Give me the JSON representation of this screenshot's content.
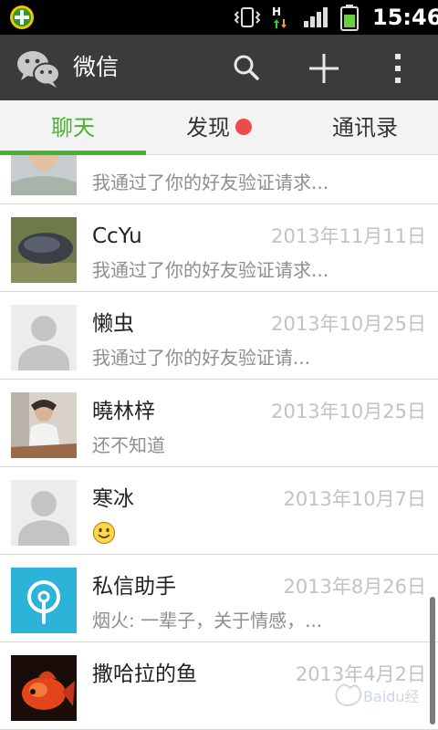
{
  "status_bar": {
    "time": "15:46",
    "network": "H"
  },
  "header": {
    "title": "微信"
  },
  "tabs": [
    {
      "label": "聊天",
      "active": true
    },
    {
      "label": "发现",
      "badge": "dot"
    },
    {
      "label": "通讯录"
    }
  ],
  "conversations": [
    {
      "name": "",
      "date": "",
      "message": "我通过了你的好友验证请求..."
    },
    {
      "name": "CcYu",
      "date": "2013年11月11日",
      "message": "我通过了你的好友验证请求..."
    },
    {
      "name": "懒虫",
      "date": "2013年10月25日",
      "message": "我通过了你的好友验证请..."
    },
    {
      "name": "曉林梓",
      "date": "2013年10月25日",
      "message": "还不知道"
    },
    {
      "name": "寒冰",
      "date": "2013年10月7日",
      "message": ""
    },
    {
      "name": "私信助手",
      "date": "2013年8月26日",
      "message": "烟火: 一辈子，关于情感，..."
    },
    {
      "name": "撒哈拉的鱼",
      "date": "2013年4月2日",
      "message": ""
    }
  ],
  "watermark": {
    "text": "Baidu经验"
  },
  "colors": {
    "accent": "#46b42d",
    "header_bg": "#3b3b3e",
    "badge": "#f04b4b"
  }
}
